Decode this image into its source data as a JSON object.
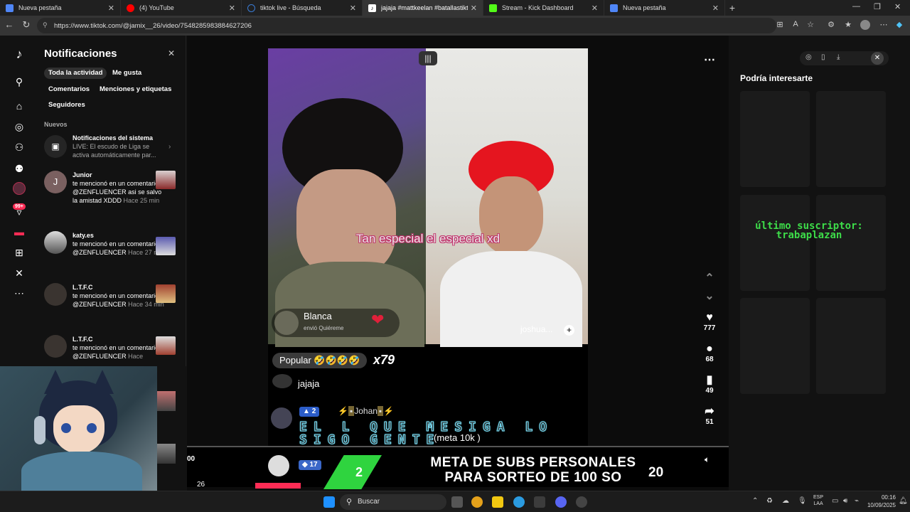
{
  "browser": {
    "tabs": [
      {
        "label": "Nueva pestaña",
        "color": "#4f86f7"
      },
      {
        "label": "(4) YouTube",
        "color": "#ff0000"
      },
      {
        "label": "tiktok live - Búsqueda",
        "color": "#3a7bd5"
      },
      {
        "label": "jajaja #mattkeelan #batallastikto",
        "color": "#111111"
      },
      {
        "label": "Stream - Kick Dashboard",
        "color": "#53fc18"
      },
      {
        "label": "Nueva pestaña",
        "color": "#4f86f7"
      }
    ],
    "active_tab": 3,
    "url": "https://www.tiktok.com/@jamix__26/video/7548285983884627206"
  },
  "notifications": {
    "title": "Notificaciones",
    "filters": [
      "Toda la actividad",
      "Me gusta",
      "Comentarios",
      "Menciones y etiquetas",
      "Seguidores"
    ],
    "section_new": "Nuevos",
    "items": [
      {
        "name": "Notificaciones del sistema",
        "text": "LIVE: El escudo de Liga se activa automáticamente par...",
        "time": ""
      },
      {
        "name": "Junior",
        "text": "te mencionó en un comentario: @ZENFLUENCER asi se salvo la amistad XDDD",
        "time": "Hace 25 min",
        "initial": "J"
      },
      {
        "name": "katy.es",
        "text": "te mencionó en un comentario: @ZENFLUENCER",
        "time": "Hace 27 min"
      },
      {
        "name": "L.T.F.C",
        "text": "te mencionó en un comentario: @ZENFLUENCER",
        "time": "Hace 34 min"
      },
      {
        "name": "L.T.F.C",
        "text": "te mencionó en un comentario: @ZENFLUENCER",
        "time": "Hace"
      }
    ]
  },
  "sidebar": {
    "badge": "99+",
    "icons": [
      "tiktok-logo-icon",
      "search-icon",
      "home-icon",
      "explore-icon",
      "following-icon",
      "friends-icon",
      "live-icon",
      "activity-icon",
      "messages-icon",
      "upload-icon",
      "profile-icon",
      "more-icon"
    ]
  },
  "video": {
    "caption": "Tan especial el especial xd",
    "gift_user": "Blanca",
    "gift_sub": "envió  Quiéreme",
    "right_user": "joshua...",
    "popular_label": "Popular 🤣🤣🤣🤣",
    "multiplier": "x79",
    "chat_comment": "jajaja",
    "chat_user_level": "2",
    "chat_user": "Johan",
    "chat_big_line1": "EL L QUE MESIGA LO",
    "chat_big_line2": "SIGO GENTE",
    "chat_meta": "(meta 10k )",
    "chat2_level": "17"
  },
  "actions": {
    "likes": "777",
    "comments": "68",
    "saves": "49",
    "shares": "51"
  },
  "rail": {
    "title": "Podría interesarte",
    "overlay_line1": "último suscriptor:",
    "overlay_line2": "trabaplazan"
  },
  "overlay": {
    "timer_left": "00",
    "bottom_num": "26",
    "goal_current": "2",
    "goal_line1": "META DE SUBS PERSONALES",
    "goal_line2": "PARA SORTEO DE 100 SO",
    "goal_target": "20"
  },
  "taskbar": {
    "search_label": "Buscar",
    "lang_line1": "ESP",
    "lang_line2": "LAA",
    "time": "00:16",
    "date": "10/09/2025"
  }
}
